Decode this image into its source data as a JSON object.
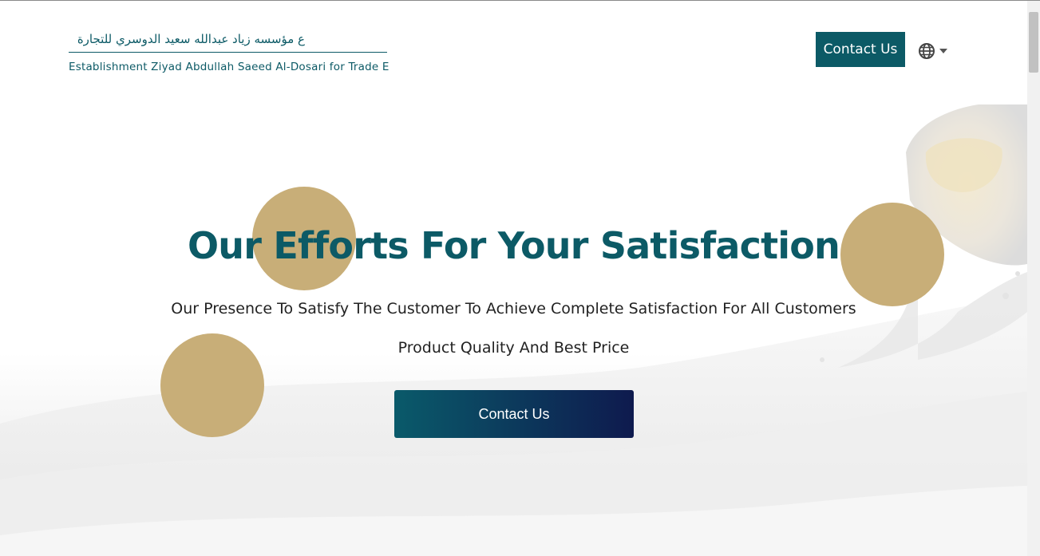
{
  "header": {
    "logo_ar": "ع مؤسسه زياد عبدالله سعيد الدوسري للتجارة",
    "logo_en": "Establishment Ziyad Abdullah Saeed Al-Dosari for Trade E",
    "contact_label": "Contact Us",
    "language_icon": "globe-icon"
  },
  "hero": {
    "title": "Our Efforts For Your Satisfaction",
    "subtitle_1": "Our Presence To Satisfy The Customer To Achieve Complete Satisfaction For All Customers",
    "subtitle_2": "Product Quality And Best Price",
    "cta_label": "Contact Us"
  },
  "colors": {
    "brand": "#0c5a66",
    "gold": "#c8ae78",
    "cta_gradient_end": "#0e1a4e"
  }
}
